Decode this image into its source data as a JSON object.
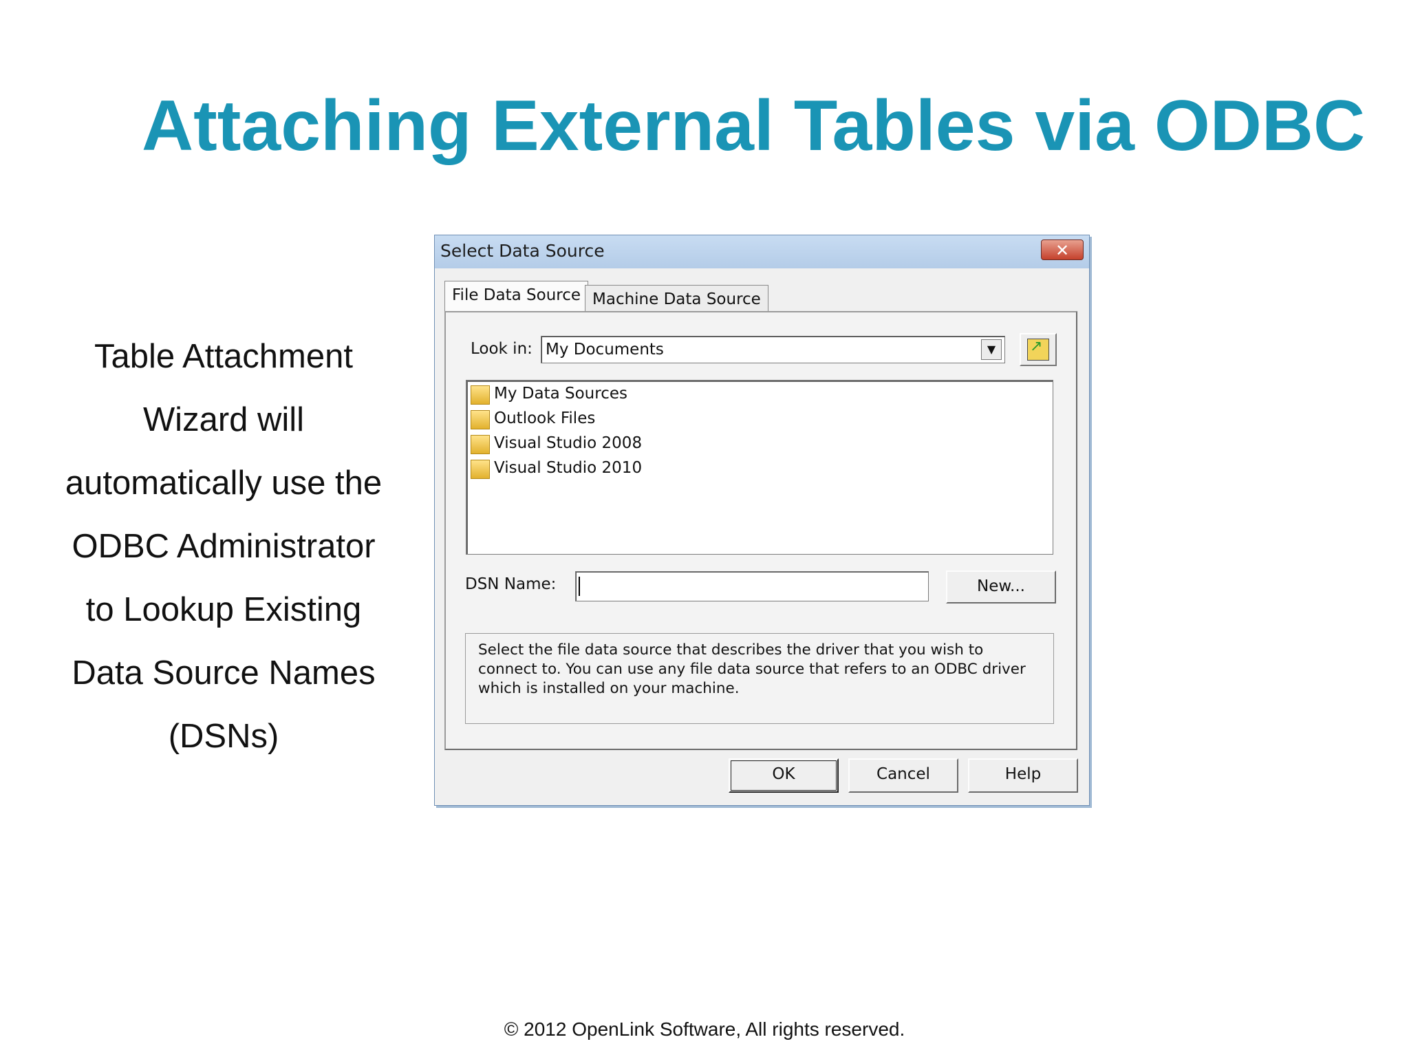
{
  "slide": {
    "title": "Attaching External Tables via ODBC",
    "side_text": [
      "Table Attachment",
      "Wizard will",
      "automatically use the",
      "ODBC Administrator",
      "to Lookup Existing",
      "Data Source Names",
      "(DSNs)"
    ],
    "footer": "© 2012 OpenLink Software, All rights reserved.",
    "title_color": "#1a94b5"
  },
  "dialog": {
    "title": "Select Data Source",
    "close_label": "✕",
    "tabs": [
      {
        "label": "File Data Source",
        "active": true
      },
      {
        "label": "Machine Data Source",
        "active": false
      }
    ],
    "look_in_label": "Look in:",
    "look_in_value": "My Documents",
    "files": [
      {
        "name": "My Data Sources",
        "icon": "special-folder-icon"
      },
      {
        "name": "Outlook Files",
        "icon": "folder-icon"
      },
      {
        "name": "Visual Studio 2008",
        "icon": "folder-icon"
      },
      {
        "name": "Visual Studio 2010",
        "icon": "folder-icon"
      }
    ],
    "dsn_label": "DSN Name:",
    "dsn_value": "",
    "new_button": "New...",
    "description": "Select the file data source that describes the driver that you wish to connect to. You can use any file data source that refers to an ODBC driver which is installed on your machine.",
    "ok_button": "OK",
    "cancel_button": "Cancel",
    "help_button": "Help"
  }
}
